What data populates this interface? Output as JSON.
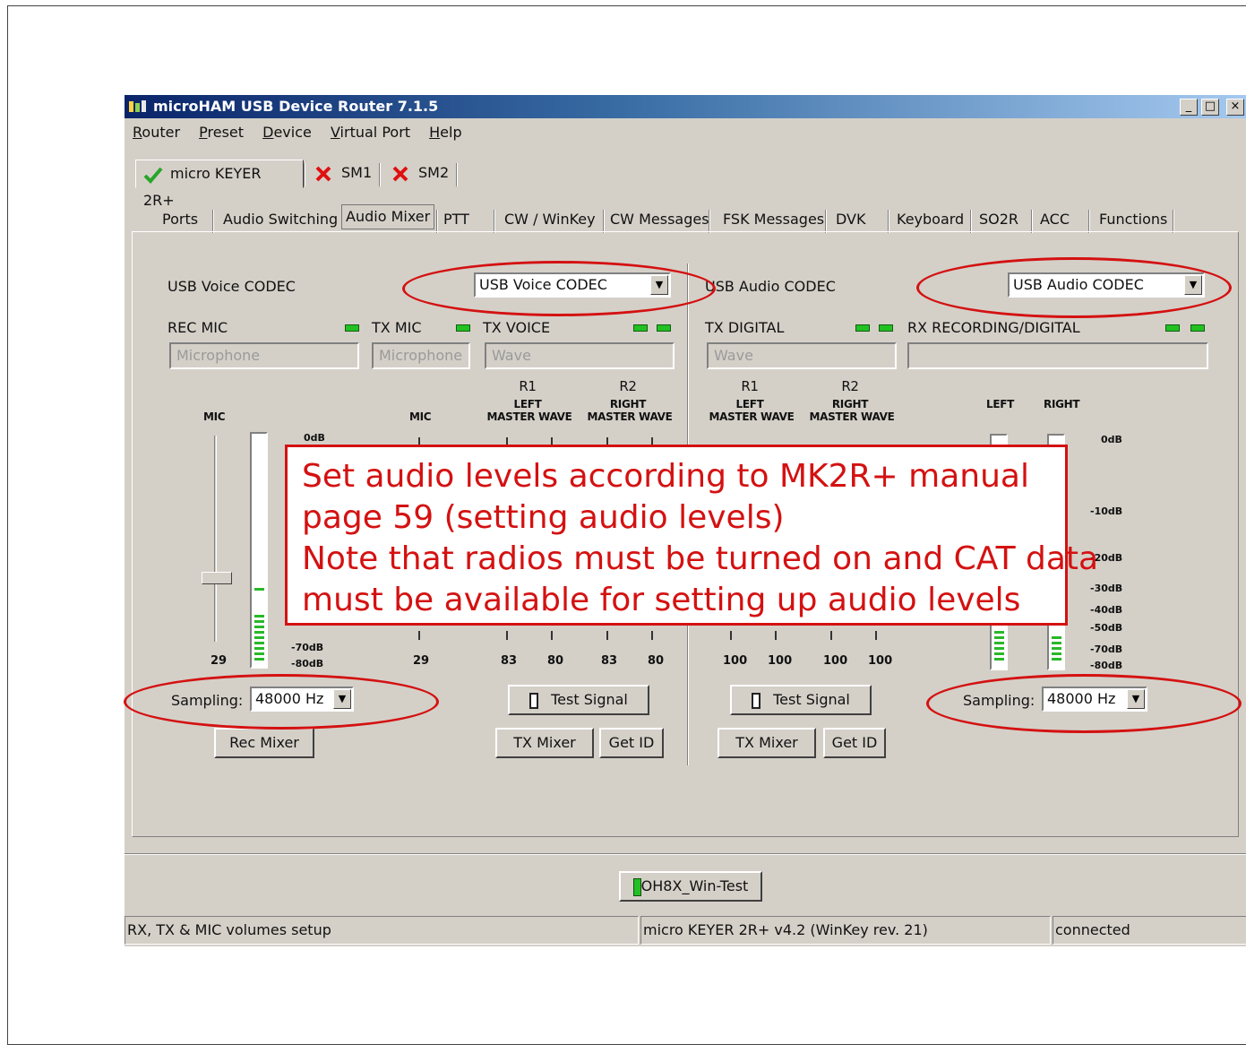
{
  "window": {
    "title": "microHAM USB Device Router 7.1.5",
    "controls": [
      "_",
      "□",
      "×"
    ]
  },
  "menu": [
    "Router",
    "Preset",
    "Device",
    "Virtual Port",
    "Help"
  ],
  "devices": [
    {
      "label": "micro KEYER 2R+",
      "status": "ok"
    },
    {
      "label": "SM1",
      "status": "error"
    },
    {
      "label": "SM2",
      "status": "error"
    }
  ],
  "tabs": [
    "Ports",
    "Audio Switching",
    "Audio Mixer",
    "PTT",
    "CW / WinKey",
    "CW Messages",
    "FSK Messages",
    "DVK",
    "Keyboard",
    "SO2R",
    "ACC",
    "Functions"
  ],
  "voice": {
    "label": "USB Voice CODEC",
    "codec_value": "USB Voice CODEC",
    "rec_mic_label": "REC MIC",
    "tx_mic_label": "TX MIC",
    "tx_voice_label": "TX VOICE",
    "rec_mic_field": "Microphone",
    "tx_mic_field": "Microphone",
    "tx_voice_field": "Wave",
    "mic_col": "MIC",
    "mic_col2": "MIC",
    "r1": "R1",
    "r1_sub1": "LEFT",
    "r1_sub2": "MASTER WAVE",
    "r2": "R2",
    "r2_sub1": "RIGHT",
    "r2_sub2": "MASTER WAVE",
    "db_0": "0dB",
    "db_70": "-70dB",
    "db_80": "-80dB",
    "values": [
      "29",
      "29",
      "83",
      "80",
      "83",
      "80"
    ],
    "rec_level": 29,
    "sampling_label": "Sampling:",
    "sampling_value": "48000 Hz",
    "rec_mixer": "Rec Mixer",
    "test_signal": "Test Signal",
    "tx_mixer": "TX Mixer",
    "get_id": "Get ID"
  },
  "audio": {
    "label": "USB Audio CODEC",
    "codec_value": "USB Audio CODEC",
    "tx_digital_label": "TX DIGITAL",
    "rx_label": "RX RECORDING/DIGITAL",
    "tx_digital_field": "Wave",
    "rx_field": "",
    "r1": "R1",
    "r1_sub1": "LEFT",
    "r1_sub2": "MASTER WAVE",
    "r2": "R2",
    "r2_sub1": "RIGHT",
    "r2_sub2": "MASTER WAVE",
    "left": "LEFT",
    "right": "RIGHT",
    "db_labels": [
      "0dB",
      "-10dB",
      "-20dB",
      "-30dB",
      "-40dB",
      "-50dB",
      "-70dB",
      "-80dB"
    ],
    "values": [
      "100",
      "100",
      "100",
      "100"
    ],
    "sampling_label": "Sampling:",
    "sampling_value": "48000 Hz",
    "test_signal": "Test Signal",
    "tx_mixer": "TX Mixer",
    "get_id": "Get ID"
  },
  "preset_button": "OH8X_Win-Test",
  "status": {
    "left": "RX, TX & MIC volumes setup",
    "middle": "micro KEYER 2R+ v4.2 (WinKey rev. 21)",
    "right": "connected"
  },
  "annotation": {
    "lines": [
      "Set audio levels according to MK2R+ manual",
      "page 59 (setting audio levels)",
      "Note that radios must be turned on and CAT data",
      "must be available for setting up audio levels"
    ]
  },
  "colors": {
    "annotation": "#d41111",
    "led": "#22c022",
    "titlebar": "#0a246a"
  }
}
